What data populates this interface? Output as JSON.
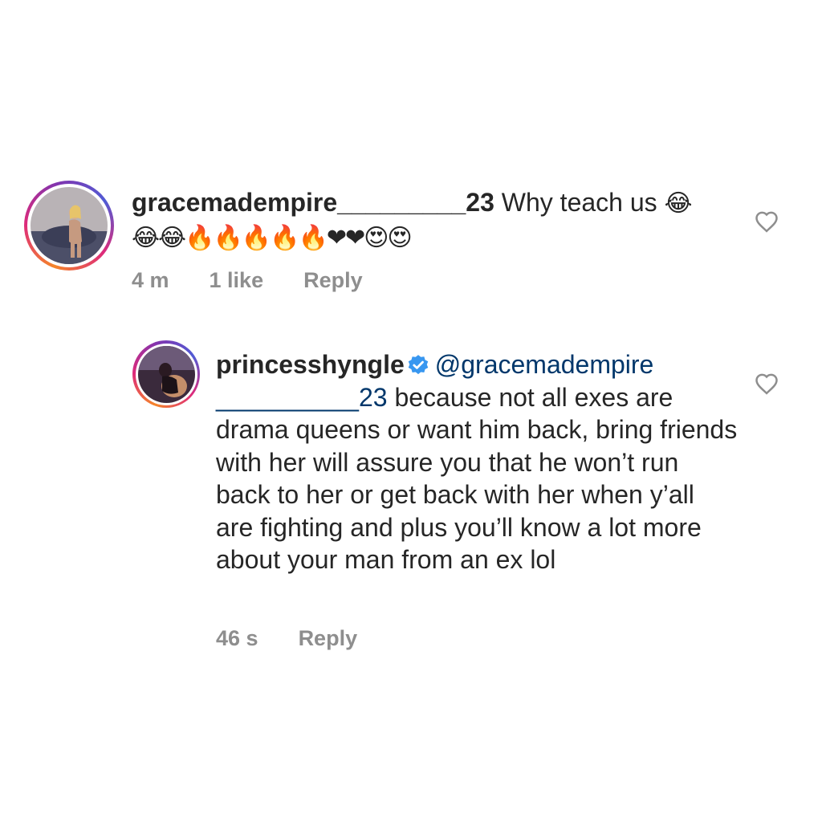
{
  "comments": [
    {
      "username": "gracemadempire_________23",
      "text": " Why teach us ",
      "emojis_line1": "😂",
      "emojis_line2": "😂😂🔥🔥🔥🔥🔥❤❤😍😍",
      "time": "4 m",
      "likes": "1 like",
      "reply": "Reply"
    },
    {
      "username": "princesshyngle",
      "verified": true,
      "mention": "@gracemadempire",
      "mention_cont": "__________23",
      "text": " because not all exes are drama queens or want him back, bring friends with her will assure you that he won’t run back to her or get back with her when y’all are fighting and plus you’ll know a lot more about your man from an ex lol",
      "time": "46 s",
      "reply": "Reply"
    }
  ],
  "colors": {
    "text": "#262626",
    "meta": "#8e8e8e",
    "mention": "#00376b",
    "verified": "#3897f0"
  },
  "icons": [
    "heart-outline-icon",
    "verified-badge-icon"
  ]
}
